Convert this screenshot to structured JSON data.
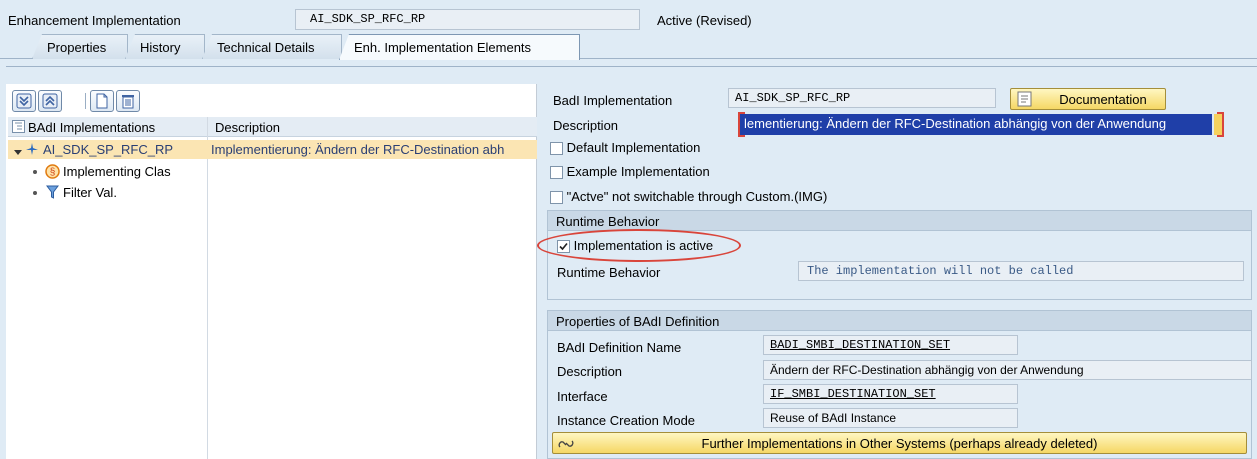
{
  "header": {
    "label": "Enhancement Implementation",
    "value": "AI_SDK_SP_RFC_RP",
    "status": "Active (Revised)"
  },
  "tabs": [
    "Properties",
    "History",
    "Technical Details",
    "Enh. Implementation Elements"
  ],
  "tree": {
    "col1": "BAdI Implementations",
    "col2": "Description",
    "root_label": "AI_SDK_SP_RFC_RP",
    "root_desc": "Implementierung: Ändern der RFC-Destination abh",
    "child1": "Implementing Clas",
    "child2": "Filter Val."
  },
  "form": {
    "badi_impl_label": "BadI Implementation",
    "badi_impl_value": "AI_SDK_SP_RFC_RP",
    "doc_button": "Documentation",
    "desc_label": "Description",
    "desc_value": "lementierung: Ändern der RFC-Destination abhängig von der Anwendung",
    "default_impl": "Default Implementation",
    "example_impl": "Example Implementation",
    "not_switchable": "\"Actve\" not switchable through Custom.(IMG)"
  },
  "runtime": {
    "title": "Runtime Behavior",
    "active_label": "Implementation is active",
    "active_checked": true,
    "behavior_label": "Runtime Behavior",
    "behavior_value": "The implementation will not be called"
  },
  "properties": {
    "title": "Properties of BAdI Definition",
    "def_name_label": "BAdI Definition Name",
    "def_name_value": "BADI_SMBI_DESTINATION_SET",
    "desc_label": "Description",
    "desc_value": "Ändern der RFC-Destination abhängig von der Anwendung",
    "interface_label": "Interface",
    "interface_value": "IF_SMBI_DESTINATION_SET",
    "instance_label": "Instance Creation Mode",
    "instance_value": "Reuse of BAdI Instance",
    "further_button": "Further Implementations in Other Systems (perhaps already deleted)"
  },
  "colors": {
    "selection": "#fbe5b3",
    "highlight_text_bg": "#1f3fa8",
    "annotation_red": "#d9453b",
    "button_yellow": "#f5d765"
  }
}
